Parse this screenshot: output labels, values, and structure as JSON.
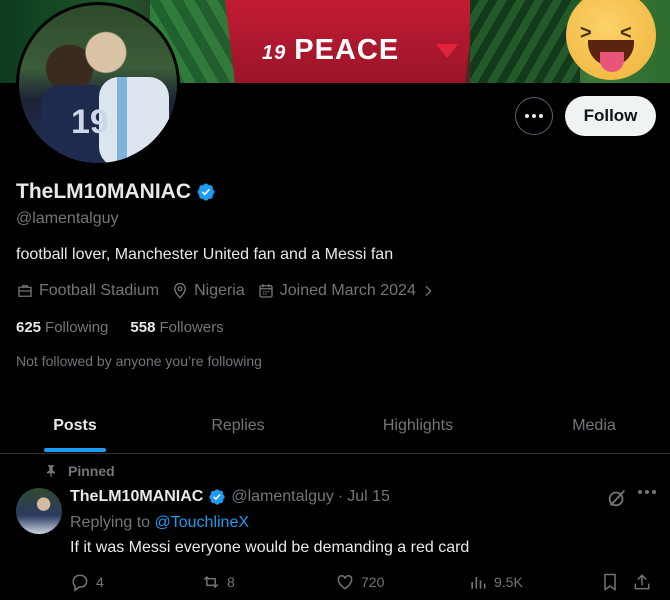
{
  "banner": {
    "number": "19",
    "text": "PEACE"
  },
  "profile": {
    "name": "TheLM10MANIAC",
    "handle": "@lamentalguy",
    "bio": "football lover, Manchester United fan and a Messi fan",
    "category": "Football Stadium",
    "location": "Nigeria",
    "joined": "Joined March 2024",
    "following_count": "625",
    "following_label": "Following",
    "followers_count": "558",
    "followers_label": "Followers",
    "not_followed": "Not followed by anyone you’re following",
    "follow_label": "Follow",
    "avatar_jersey_number": "19"
  },
  "tabs": [
    {
      "label": "Posts",
      "active": true
    },
    {
      "label": "Replies",
      "active": false
    },
    {
      "label": "Highlights",
      "active": false
    },
    {
      "label": "Media",
      "active": false
    }
  ],
  "tweet": {
    "pinned_label": "Pinned",
    "name": "TheLM10MANIAC",
    "handle": "@lamentalguy",
    "separator": "·",
    "date": "Jul 15",
    "replying_to_label": "Replying to",
    "replying_to": "@TouchlineX",
    "text": "If it was Messi everyone would be demanding a red card",
    "replies": "4",
    "reposts": "8",
    "likes": "720",
    "views": "9.5K"
  },
  "colors": {
    "accent": "#1d9bf0",
    "background": "#000000",
    "text_primary": "#e7e9ea",
    "text_secondary": "#71767b",
    "follow_button_bg": "#eff3f4"
  }
}
